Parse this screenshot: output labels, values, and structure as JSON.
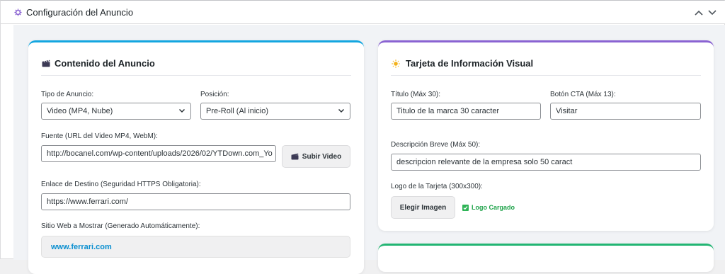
{
  "metabox": {
    "title": "Configuración del Anuncio",
    "icon": "gear-icon",
    "collapse_up_icon": "chevron-up-icon",
    "collapse_down_icon": "chevron-down-icon"
  },
  "content_card": {
    "icon": "clapperboard-icon",
    "title": "Contenido del Anuncio",
    "accent": "#13a6e0",
    "ad_type": {
      "label": "Tipo de Anuncio:",
      "value": "Video (MP4, Nube)"
    },
    "position": {
      "label": "Posición:",
      "value": "Pre-Roll (Al inicio)"
    },
    "source": {
      "label": "Fuente (URL del Video MP4, WebM):",
      "value": "http://bocanel.com/wp-content/uploads/2026/02/YTDown.com_Yo",
      "upload_label": "Subir Video",
      "upload_icon": "clapperboard-icon"
    },
    "destination": {
      "label": "Enlace de Destino (Seguridad HTTPS Obligatoria):",
      "value": "https://www.ferrari.com/"
    },
    "site": {
      "label": "Sitio Web a Mostrar (Generado Automáticamente):",
      "value": "www.ferrari.com"
    }
  },
  "visual_card": {
    "icon": "sun-icon",
    "title": "Tarjeta de Información Visual",
    "accent": "#8a63d2",
    "title_field": {
      "label": "Título (Máx 30):",
      "value": "Titulo de la marca 30 caracter"
    },
    "cta_field": {
      "label": "Botón CTA (Máx 13):",
      "value": "Visitar"
    },
    "description": {
      "label": "Descripción Breve (Máx 50):",
      "value": "descripcion relevante de la empresa solo 50 caract"
    },
    "logo": {
      "label": "Logo de la Tarjeta (300x300):",
      "button_label": "Elegir Imagen",
      "status": "Logo Cargado",
      "status_icon": "check-icon"
    }
  },
  "bottom_card": {
    "accent": "#22b573"
  }
}
